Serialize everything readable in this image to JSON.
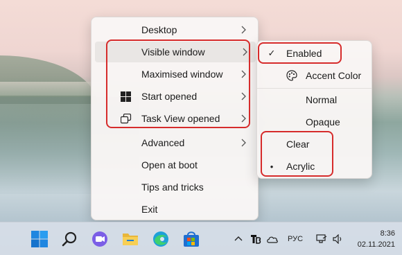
{
  "main_menu": {
    "items": [
      {
        "label": "Desktop",
        "has_submenu": true
      },
      {
        "label": "Visible window",
        "has_submenu": true
      },
      {
        "label": "Maximised window",
        "has_submenu": true
      },
      {
        "label": "Start opened",
        "has_submenu": true,
        "icon": "windows-logo-icon"
      },
      {
        "label": "Task View opened",
        "has_submenu": true,
        "icon": "task-view-icon"
      },
      {
        "label": "Advanced",
        "has_submenu": true
      },
      {
        "label": "Open at boot",
        "has_submenu": false
      },
      {
        "label": "Tips and tricks",
        "has_submenu": false
      },
      {
        "label": "Exit",
        "has_submenu": false
      }
    ]
  },
  "sub_menu": {
    "items": [
      {
        "label": "Enabled",
        "mark": "✓"
      },
      {
        "label": "Accent Color",
        "icon": "palette-icon"
      },
      {
        "label": "Normal"
      },
      {
        "label": "Opaque"
      },
      {
        "label": "Clear"
      },
      {
        "label": "Acrylic",
        "mark": "•"
      }
    ]
  },
  "tray": {
    "language": "РУС",
    "time": "8:36",
    "date": "02.11.2021"
  },
  "colors": {
    "highlight": "#d62b2b",
    "accent": "#0067c0"
  }
}
